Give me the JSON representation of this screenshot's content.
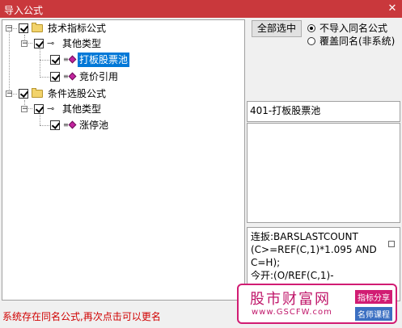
{
  "window": {
    "title": "导入公式",
    "close_glyph": "✕"
  },
  "tree": {
    "nodes": [
      {
        "label": "技术指标公式",
        "kind": "folder",
        "expanded": true,
        "checked": true
      },
      {
        "label": "其他类型",
        "kind": "group",
        "expanded": true,
        "checked": true
      },
      {
        "label": "打板股票池",
        "kind": "formula",
        "checked": true,
        "selected": true
      },
      {
        "label": "竞价引用",
        "kind": "formula",
        "checked": true
      },
      {
        "label": "条件选股公式",
        "kind": "folder",
        "expanded": true,
        "checked": true
      },
      {
        "label": "其他类型",
        "kind": "group",
        "expanded": true,
        "checked": true
      },
      {
        "label": "涨停池",
        "kind": "formula",
        "checked": true
      }
    ],
    "expanded_glyph": "−"
  },
  "controls": {
    "select_all_label": "全部选中",
    "radio_options": [
      {
        "label": "不导入同名公式",
        "checked": true
      },
      {
        "label": "覆盖同名(非系统)",
        "checked": false
      }
    ]
  },
  "info": {
    "text": "401-打板股票池"
  },
  "code": {
    "lines": [
      "连扳:BARSLASTCOUNT",
      "(C>=REF(C,1)*1.095 AND",
      "C=H);",
      "今开:(O/REF(C,1)-"
    ]
  },
  "status": {
    "text": "系统存在同名公式,再次点击可以更名"
  },
  "watermark": {
    "brand": "股市财富网",
    "url": "www.GSCFW.com",
    "tag1": "指标分享",
    "tag2": "名师课程"
  }
}
